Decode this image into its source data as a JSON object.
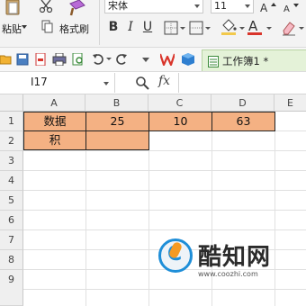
{
  "ribbon": {
    "paste_label": "粘贴",
    "format_painter_label": "格式刷",
    "font_name": "宋体",
    "font_size": "11",
    "bold_label": "B",
    "italic_label": "I",
    "underline_label": "U",
    "font_color_label": "A",
    "accent_color": "#d9352b"
  },
  "quick_access": {
    "document_tab": "工作簿1 *"
  },
  "formula_bar": {
    "cell_ref": "I17",
    "fx_label": "fx",
    "formula": ""
  },
  "sheet": {
    "columns": [
      "A",
      "B",
      "C",
      "D",
      "E"
    ],
    "rows": [
      "1",
      "2",
      "3",
      "4",
      "5",
      "6",
      "7",
      "8",
      "9"
    ],
    "cells": {
      "A1": "数据",
      "B1": "25",
      "C1": "10",
      "D1": "63",
      "A2": "积",
      "B2": ""
    },
    "highlight_color": "#f4b183"
  },
  "watermark": {
    "brand": "酷知网",
    "url": "www.coozhi.com"
  }
}
